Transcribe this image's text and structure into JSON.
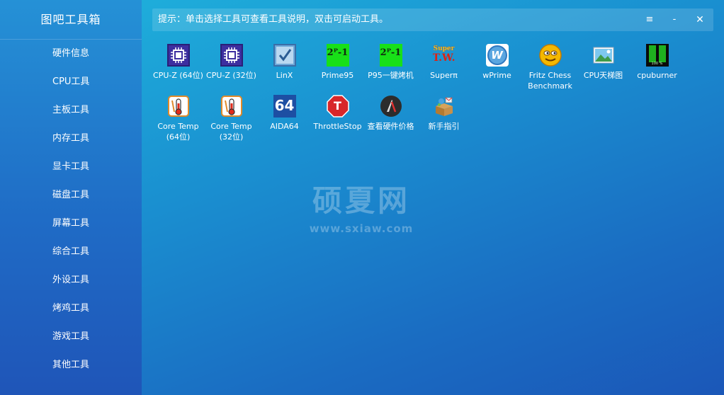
{
  "app": {
    "title": "图吧工具箱"
  },
  "sidebar": {
    "items": [
      {
        "label": "硬件信息"
      },
      {
        "label": "CPU工具"
      },
      {
        "label": "主板工具"
      },
      {
        "label": "内存工具"
      },
      {
        "label": "显卡工具"
      },
      {
        "label": "磁盘工具"
      },
      {
        "label": "屏幕工具"
      },
      {
        "label": "综合工具"
      },
      {
        "label": "外设工具"
      },
      {
        "label": "烤鸡工具"
      },
      {
        "label": "游戏工具"
      },
      {
        "label": "其他工具"
      }
    ]
  },
  "hint": {
    "text": "提示：单击选择工具可查看工具说明，双击可启动工具。"
  },
  "window_controls": {
    "menu": "≡",
    "minimize": "-",
    "close": "✕"
  },
  "tools": [
    {
      "label": "CPU-Z (64位)",
      "icon": "cpu-z-icon"
    },
    {
      "label": "CPU-Z (32位)",
      "icon": "cpu-z-icon"
    },
    {
      "label": "LinX",
      "icon": "linx-icon"
    },
    {
      "label": "Prime95",
      "icon": "prime95-icon",
      "glyph": "2ᴾ-1"
    },
    {
      "label": "P95一键烤机",
      "icon": "prime95-icon",
      "glyph": "2ᴾ-1"
    },
    {
      "label": "Superπ",
      "icon": "superpi-icon",
      "glyph": "Super",
      "glyph2": "T.W."
    },
    {
      "label": "wPrime",
      "icon": "wprime-icon",
      "glyph": "W"
    },
    {
      "label": "Fritz Chess\nBenchmark",
      "icon": "fritz-chess-icon"
    },
    {
      "label": "CPU天梯图",
      "icon": "image-icon"
    },
    {
      "label": "cpuburner",
      "icon": "cpuburner-icon",
      "glyph": "100 %"
    },
    {
      "label": "Core Temp\n(64位)",
      "icon": "thermometer-icon"
    },
    {
      "label": "Core Temp\n(32位)",
      "icon": "thermometer-icon"
    },
    {
      "label": "AIDA64",
      "icon": "aida64-icon",
      "glyph": "64"
    },
    {
      "label": "ThrottleStop",
      "icon": "throttlestop-icon",
      "glyph": "T"
    },
    {
      "label": "查看硬件价格",
      "icon": "price-icon"
    },
    {
      "label": "新手指引",
      "icon": "guide-icon"
    }
  ],
  "watermark": {
    "text": "硕夏网",
    "url": "www.sxiaw.com"
  },
  "colors": {
    "sidebar_bg": "#1f6cc6",
    "content_bg_top": "#1fb4dd",
    "content_bg_bottom": "#1b57b8",
    "text": "#ffffff"
  }
}
